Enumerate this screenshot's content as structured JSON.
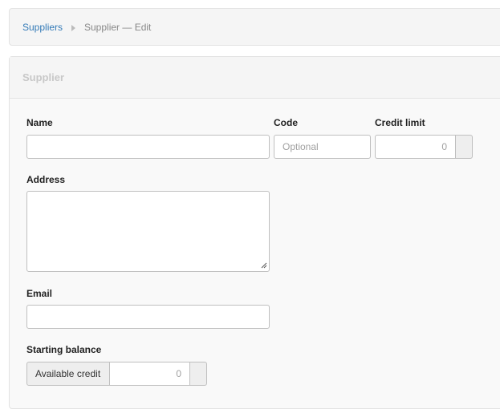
{
  "breadcrumb": {
    "parent": "Suppliers",
    "current": "Supplier — Edit"
  },
  "panel": {
    "title": "Supplier"
  },
  "form": {
    "name": {
      "label": "Name",
      "value": ""
    },
    "code": {
      "label": "Code",
      "placeholder": "Optional",
      "value": ""
    },
    "credit_limit": {
      "label": "Credit limit",
      "placeholder": "0"
    },
    "address": {
      "label": "Address",
      "value": ""
    },
    "email": {
      "label": "Email",
      "value": ""
    },
    "starting_balance": {
      "label": "Starting balance",
      "prefix": "Available credit",
      "placeholder": "0"
    }
  },
  "icons": {
    "breadcrumb_separator": "caret-right-icon",
    "textarea_resize": "resize-grip-icon"
  }
}
